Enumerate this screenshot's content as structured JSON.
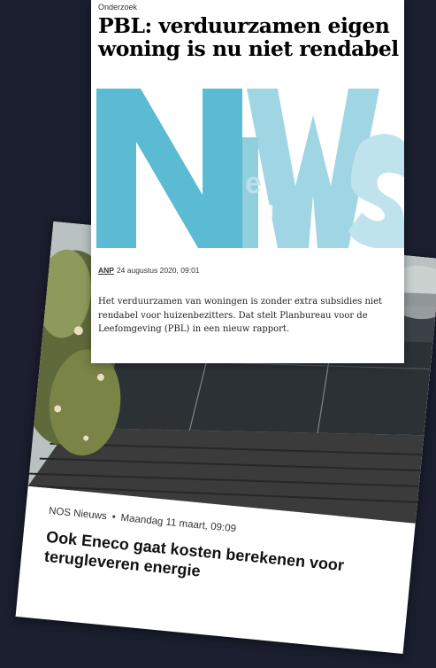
{
  "nos": {
    "source": "NOS Nieuws",
    "date": "Maandag 11 maart, 09:09",
    "title": "Ook Eneco gaat kosten berekenen voor terugleveren energie"
  },
  "anp": {
    "category": "Onderzoek",
    "headline": "PBL: verduurzamen eigen woning is nu niet rendabel",
    "agency": "ANP",
    "date": "24 augustus 2020, 09:01",
    "body": "Het verduurzamen van woningen is zonder extra subsidies niet rendabel voor huizenbezitters. Dat stelt Planbureau voor de Leefomgeving (PBL) in een nieuw rapport.",
    "logo_colors": [
      "#5bbbd2",
      "#8fcfde",
      "#bfe3ec"
    ]
  }
}
